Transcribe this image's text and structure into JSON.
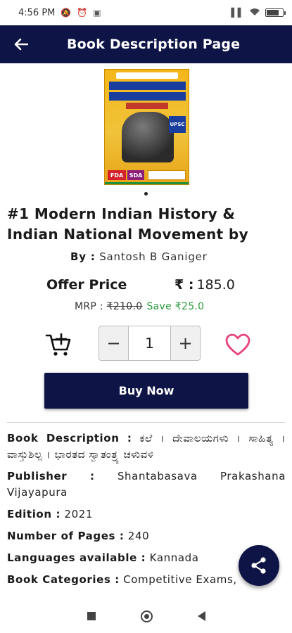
{
  "status_bar": {
    "time": "4:56 PM",
    "left_icons": [
      "mute-icon",
      "alarm-icon",
      "screenshot-icon"
    ],
    "right_icons": [
      "signal-icon",
      "wifi-icon",
      "battery-icon"
    ]
  },
  "app_bar": {
    "title": "Book Description Page",
    "back_icon": "←"
  },
  "book": {
    "cover_fda": "FDA",
    "cover_sda": "SDA",
    "cover_upsc": "UPSC",
    "title": "#1 Modern Indian History & Indian National Movement by",
    "author_label": "By :",
    "author": "Santosh B Ganiger",
    "offer_label": "Offer Price",
    "currency": "₹ :",
    "offer_price": "185.0",
    "mrp_label": "MRP : ",
    "mrp_value": "₹210.0",
    "save_text": "Save ₹25.0",
    "quantity": "1",
    "minus": "−",
    "plus": "+",
    "buy_label": "Buy Now"
  },
  "details": {
    "description_label": "Book Description :",
    "description_value": "ಕಲೆ । ದೇವಾಲಯಗಳು । ಸಾಹಿತ್ಯ । ವಾಸ್ತುಶಿಲ್ಪ । ಭಾರತದ ಸ್ವಾತಂತ್ರ್ಯ ಚಳುವಳಿ",
    "publisher_label": "Publisher :",
    "publisher_value": "Shantabasava Prakashana Vijayapura",
    "edition_label": "Edition :",
    "edition_value": "2021",
    "pages_label": "Number of Pages :",
    "pages_value": "240",
    "languages_label": "Languages available :",
    "languages_value": "Kannada",
    "categories_label": "Book Categories :",
    "categories_value": "Competitive Exams,"
  },
  "colors": {
    "primary": "#0e1446",
    "save_green": "#2e9b3e",
    "heart_pink": "#e8457a"
  }
}
